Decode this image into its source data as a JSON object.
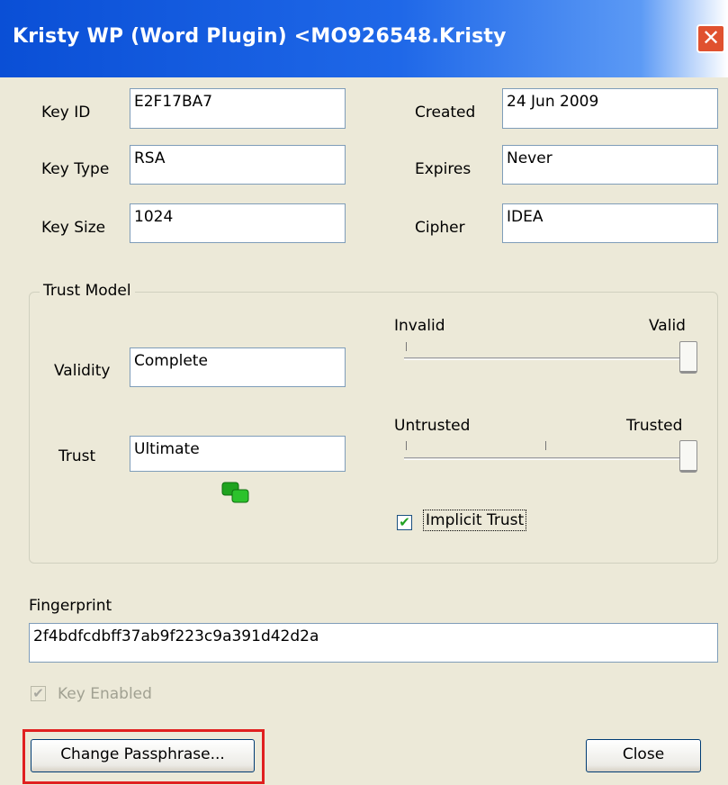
{
  "window": {
    "title": "Kristy WP (Word Plugin) <MO926548.Kristy",
    "close_glyph": "✕"
  },
  "key": {
    "id_label": "Key ID",
    "id_value": "E2F17BA7",
    "type_label": "Key Type",
    "type_value": "RSA",
    "size_label": "Key Size",
    "size_value": "1024",
    "created_label": "Created",
    "created_value": "24 Jun 2009",
    "expires_label": "Expires",
    "expires_value": "Never",
    "cipher_label": "Cipher",
    "cipher_value": "IDEA"
  },
  "trust_model": {
    "group_label": "Trust Model",
    "validity_label": "Validity",
    "validity_value": "Complete",
    "trust_label": "Trust",
    "trust_value": "Ultimate",
    "validity_slider": {
      "min_label": "Invalid",
      "max_label": "Valid",
      "value_fraction": 1.0
    },
    "trust_slider": {
      "min_label": "Untrusted",
      "max_label": "Trusted",
      "value_fraction": 1.0
    },
    "implicit_trust_label": "Implicit Trust",
    "implicit_trust_checked": true,
    "status_icon": "green-keys-icon",
    "status_color": "#1fa31f"
  },
  "fingerprint": {
    "label": "Fingerprint",
    "value": "2f4bdfcdbff37ab9f223c9a391d42d2a"
  },
  "key_enabled": {
    "label": "Key Enabled",
    "checked": true,
    "disabled": true
  },
  "buttons": {
    "change_passphrase": "Change Passphrase...",
    "close": "Close"
  },
  "colors": {
    "titlebar": "#0a4fd6",
    "highlight": "#e02020"
  }
}
